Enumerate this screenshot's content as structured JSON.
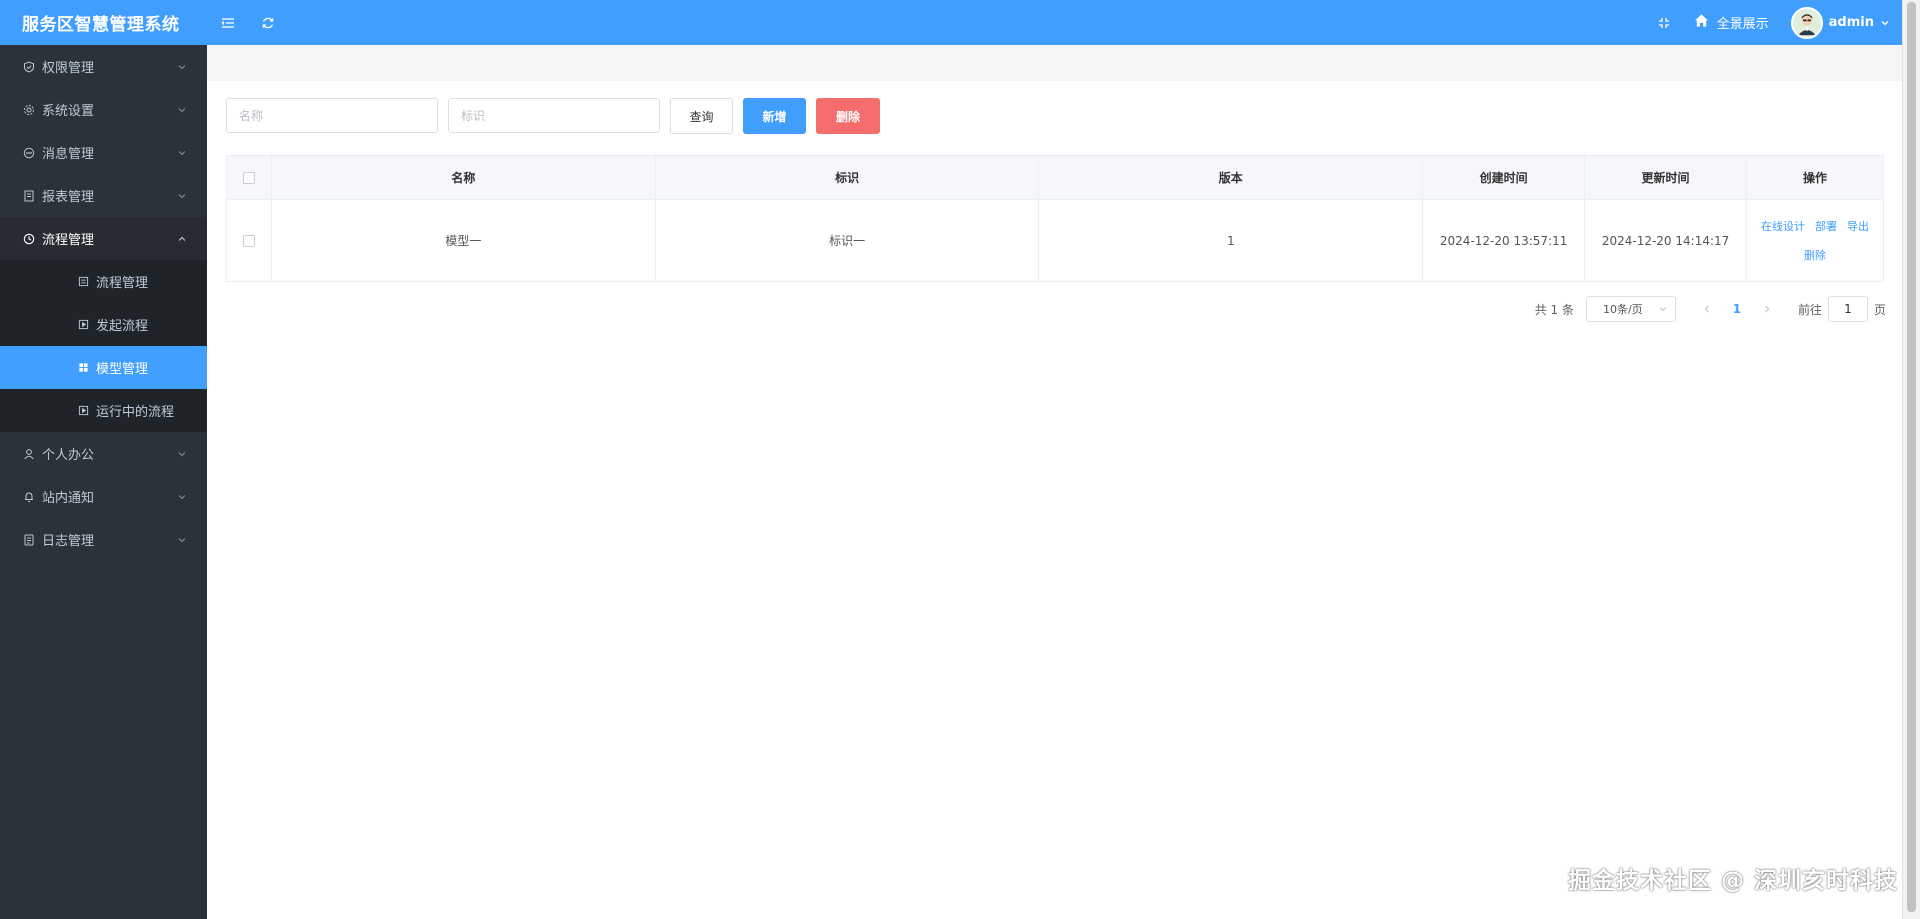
{
  "header": {
    "title": "服务区智慧管理系统",
    "home_label": "全景展示",
    "username": "admin"
  },
  "sidebar": {
    "items": [
      {
        "label": "权限管理",
        "icon": "shield-icon"
      },
      {
        "label": "系统设置",
        "icon": "gear-icon"
      },
      {
        "label": "消息管理",
        "icon": "chat-icon"
      },
      {
        "label": "报表管理",
        "icon": "report-icon"
      },
      {
        "label": "流程管理",
        "icon": "clock-icon",
        "open": true
      },
      {
        "label": "个人办公",
        "icon": "user-icon"
      },
      {
        "label": "站内通知",
        "icon": "bell-icon"
      },
      {
        "label": "日志管理",
        "icon": "document-icon"
      }
    ],
    "sub_items": [
      {
        "label": "流程管理",
        "icon": "list-icon"
      },
      {
        "label": "发起流程",
        "icon": "play-icon"
      },
      {
        "label": "模型管理",
        "icon": "grid-icon",
        "active": true
      },
      {
        "label": "运行中的流程",
        "icon": "play-icon"
      }
    ]
  },
  "search": {
    "name_placeholder": "名称",
    "key_placeholder": "标识",
    "query_label": "查询",
    "add_label": "新增",
    "delete_label": "删除"
  },
  "table": {
    "columns": [
      "名称",
      "标识",
      "版本",
      "创建时间",
      "更新时间",
      "操作"
    ],
    "rows": [
      {
        "name": "模型一",
        "key": "标识一",
        "version": "1",
        "created": "2024-12-20 13:57:11",
        "updated": "2024-12-20 14:14:17",
        "actions": [
          "在线设计",
          "部署",
          "导出",
          "删除"
        ]
      }
    ]
  },
  "pagination": {
    "total": "共 1 条",
    "page_size": "10条/页",
    "current_page": "1",
    "goto_label": "前往",
    "goto_value": "1",
    "page_suffix": "页"
  },
  "watermark": "掘金技术社区 @ 深圳亥时科技",
  "colors": {
    "primary": "#409eff",
    "danger": "#f56c6c",
    "sidebar_bg": "#2b3238"
  }
}
